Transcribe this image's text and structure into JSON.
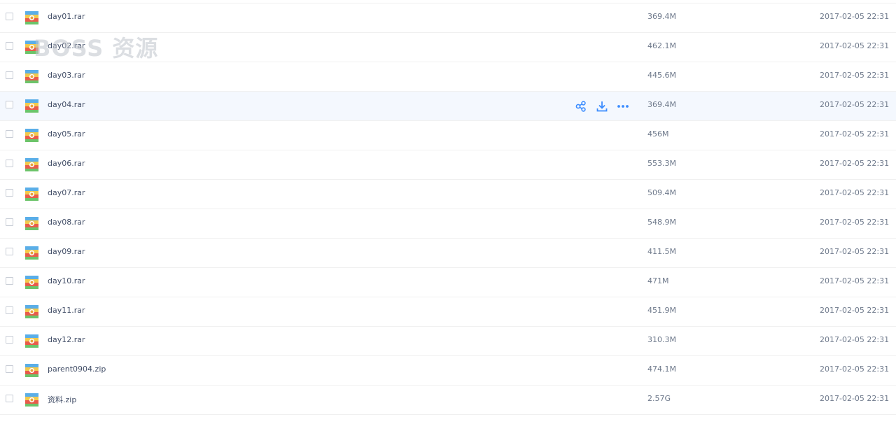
{
  "files": [
    {
      "name": "day01.rar",
      "size": "369.4M",
      "date": "2017-02-05 22:31",
      "icon": "rar-archive-icon"
    },
    {
      "name": "day02.rar",
      "size": "462.1M",
      "date": "2017-02-05 22:31",
      "icon": "rar-archive-icon"
    },
    {
      "name": "day03.rar",
      "size": "445.6M",
      "date": "2017-02-05 22:31",
      "icon": "rar-archive-icon"
    },
    {
      "name": "day04.rar",
      "size": "369.4M",
      "date": "2017-02-05 22:31",
      "icon": "rar-archive-icon",
      "hovered": true
    },
    {
      "name": "day05.rar",
      "size": "456M",
      "date": "2017-02-05 22:31",
      "icon": "rar-archive-icon"
    },
    {
      "name": "day06.rar",
      "size": "553.3M",
      "date": "2017-02-05 22:31",
      "icon": "rar-archive-icon"
    },
    {
      "name": "day07.rar",
      "size": "509.4M",
      "date": "2017-02-05 22:31",
      "icon": "rar-archive-icon"
    },
    {
      "name": "day08.rar",
      "size": "548.9M",
      "date": "2017-02-05 22:31",
      "icon": "rar-archive-icon"
    },
    {
      "name": "day09.rar",
      "size": "411.5M",
      "date": "2017-02-05 22:31",
      "icon": "rar-archive-icon"
    },
    {
      "name": "day10.rar",
      "size": "471M",
      "date": "2017-02-05 22:31",
      "icon": "rar-archive-icon"
    },
    {
      "name": "day11.rar",
      "size": "451.9M",
      "date": "2017-02-05 22:31",
      "icon": "rar-archive-icon"
    },
    {
      "name": "day12.rar",
      "size": "310.3M",
      "date": "2017-02-05 22:31",
      "icon": "rar-archive-icon"
    },
    {
      "name": "parent0904.zip",
      "size": "474.1M",
      "date": "2017-02-05 22:31",
      "icon": "zip-archive-icon"
    },
    {
      "name": "资料.zip",
      "size": "2.57G",
      "date": "2017-02-05 22:31",
      "icon": "zip-archive-icon"
    }
  ],
  "hover_actions": [
    "share-icon",
    "download-icon",
    "more-icon"
  ],
  "watermark": "BOSS 资源",
  "colors": {
    "accent": "#3b8cff",
    "row_hover": "#f4f8fe",
    "divider": "#f0f0f0",
    "text": "#424e67",
    "muted_text": "#6f7a8c"
  }
}
